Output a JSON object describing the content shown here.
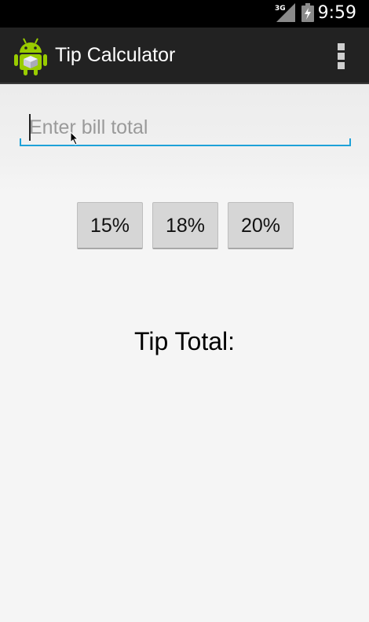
{
  "status_bar": {
    "time": "9:59",
    "network_type": "3G",
    "signal_icon": "cell-signal-icon",
    "battery_icon": "battery-charging-icon"
  },
  "action_bar": {
    "app_icon": "android-app-icon",
    "title": "Tip Calculator",
    "overflow_icon": "overflow-menu-icon"
  },
  "bill_input": {
    "value": "",
    "placeholder": "Enter bill total",
    "accent_color": "#1ea1d8"
  },
  "tip_buttons": [
    {
      "label": "15%"
    },
    {
      "label": "18%"
    },
    {
      "label": "20%"
    }
  ],
  "result": {
    "label": "Tip Total:"
  }
}
